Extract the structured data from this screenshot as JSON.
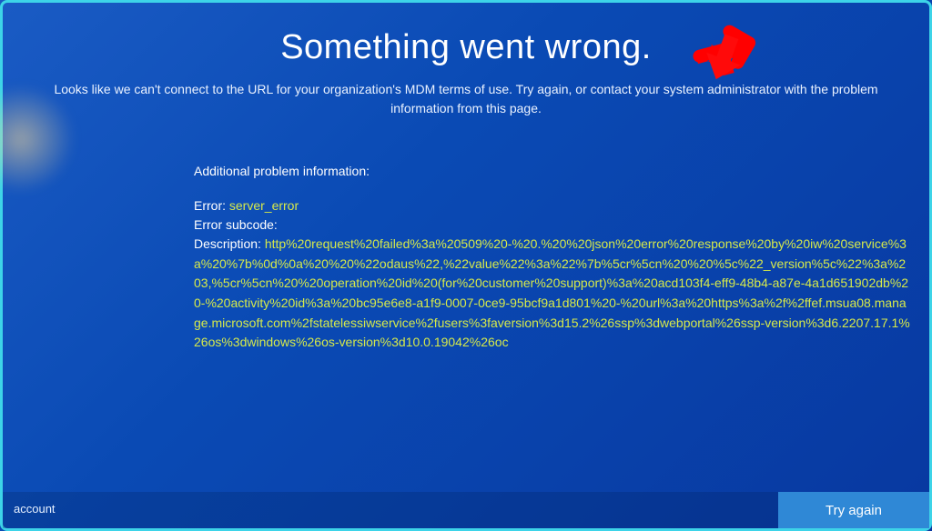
{
  "title": "Something went wrong.",
  "subtitle": "Looks like we can't connect to the URL for your organization's MDM terms of use. Try again, or contact your system administrator with the problem information from this page.",
  "problem": {
    "heading": "Additional problem information:",
    "error_label": "Error:",
    "error_value": "server_error",
    "subcode_label": "Error subcode:",
    "subcode_value": "",
    "description_label": "Description:",
    "description_value": "http%20request%20failed%3a%20509%20-%20.%20%20json%20error%20response%20by%20iw%20service%3a%20%7b%0d%0a%20%20%22odaus%22,%22value%22%3a%22%7b%5cr%5cn%20%20%5c%22_version%5c%22%3a%203,%5cr%5cn%20%20operation%20id%20(for%20customer%20support)%3a%20acd103f4-eff9-48b4-a87e-4a1d651902db%20-%20activity%20id%3a%20bc95e6e8-a1f9-0007-0ce9-95bcf9a1d801%20-%20url%3a%20https%3a%2f%2ffef.msua08.manage.microsoft.com%2fstatelessiwservice%2fusers%3faversion%3d15.2%26ssp%3dwebportal%26ssp-version%3d6.2207.17.1%26os%3dwindows%26os-version%3d10.0.19042%26oc"
  },
  "footer": {
    "account_label": "account",
    "try_again_label": "Try again"
  },
  "annotation": {
    "arrow_color": "#ff0000"
  }
}
